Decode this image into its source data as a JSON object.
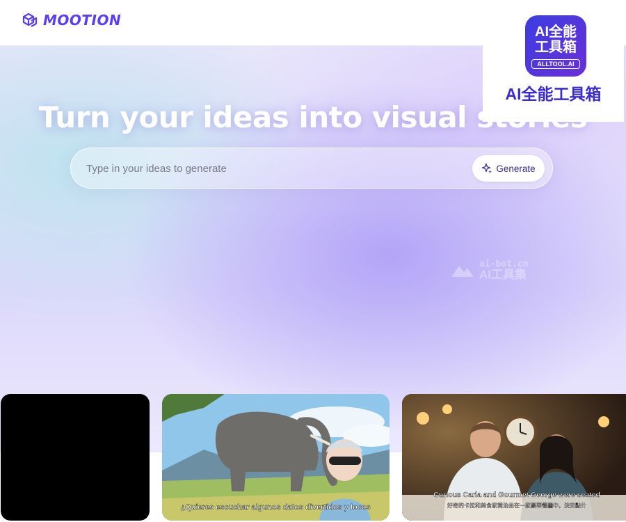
{
  "header": {
    "brand": "MOOTION"
  },
  "hero": {
    "title": "Turn your ideas into visual stories",
    "prompt_placeholder": "Type in your ideas to generate",
    "generate_label": "Generate"
  },
  "watermark": {
    "center_url": "ai-bot.cn",
    "center_name": "AI工具集"
  },
  "badge": {
    "icon_line1": "AI全能",
    "icon_line2": "工具箱",
    "icon_url": "ALLTOOL.AI",
    "name": "AI全能工具箱"
  },
  "cards": [
    {
      "caption": ""
    },
    {
      "caption": "¿Quieres escuchar algunos datos divertidos y locos"
    },
    {
      "caption": "Curious Carla and Gourmet George were seated",
      "subcaption": "好奇的卡拉和美食家喬治坐在一家豪華餐廳中，決定點什"
    }
  ],
  "colors": {
    "brand": "#5b3df5",
    "badge": "#3a2bd6"
  }
}
